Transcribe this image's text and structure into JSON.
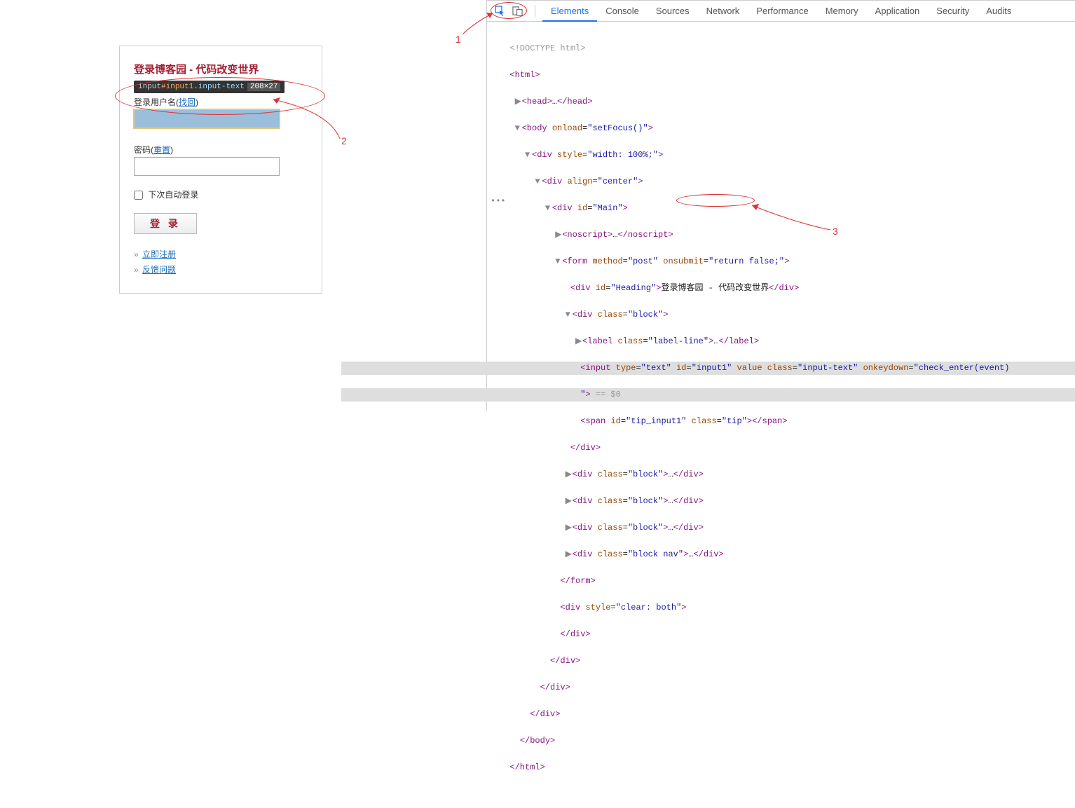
{
  "login": {
    "heading": "登录博客园 - 代码改变世界",
    "tooltip_tag": "input",
    "tooltip_id": "#input1",
    "tooltip_class": ".input-text",
    "tooltip_size": "208×27",
    "username_label": "登录用户名(",
    "username_link": "找回",
    "close_paren": ")",
    "password_label": "密码(",
    "password_link": "重置",
    "remember_label": "下次自动登录",
    "login_button": "登 录",
    "register_prefix": "» ",
    "register_link": "立即注册",
    "feedback_prefix": "» ",
    "feedback_link": "反馈问题"
  },
  "annotations": {
    "n1": "1",
    "n2": "2",
    "n3": "3"
  },
  "devtools": {
    "tabs": [
      "Elements",
      "Console",
      "Sources",
      "Network",
      "Performance",
      "Memory",
      "Application",
      "Security",
      "Audits"
    ],
    "active_tab": "Elements",
    "dom": {
      "l0": "<!DOCTYPE html>",
      "l1_open": "<html>",
      "l2": "<head>…</head>",
      "l3_body_open": "<body onload=\"setFocus()\">",
      "l4_div1_open": "<div style=\"width: 100%;\">",
      "l5_div2_open": "<div align=\"center\">",
      "l6_main_open": "<div id=\"Main\">",
      "l7_noscript": "<noscript>…</noscript>",
      "l8_form_open": "<form method=\"post\" onsubmit=\"return false;\">",
      "l9_heading": "<div id=\"Heading\">登录博客园 - 代码改变世界</div>",
      "l10_block_open": "<div class=\"block\">",
      "l11_label": "<label class=\"label-line\">…</label>",
      "l12_input_a": "<input type=\"text\" ",
      "l12_input_id_attr": "id",
      "l12_input_id_val": "input1",
      "l12_input_b": " value class=\"input-text\" onkeydown=\"check_enter(event)",
      "l12_cont": "\"> == $0",
      "l13_span": "<span id=\"tip_input1\" class=\"tip\"></span>",
      "l14_block_close": "</div>",
      "l15": "<div class=\"block\">…</div>",
      "l16": "<div class=\"block\">…</div>",
      "l17": "<div class=\"block\">…</div>",
      "l18": "<div class=\"block nav\">…</div>",
      "l19_form_close": "</form>",
      "l20_clear": "<div style=\"clear: both\">",
      "l21_div_close": "</div>",
      "l22": "</div>",
      "l23": "</div>",
      "l24": "</div>",
      "l25_body_close": "</body>",
      "l26_html_close": "</html>"
    }
  }
}
